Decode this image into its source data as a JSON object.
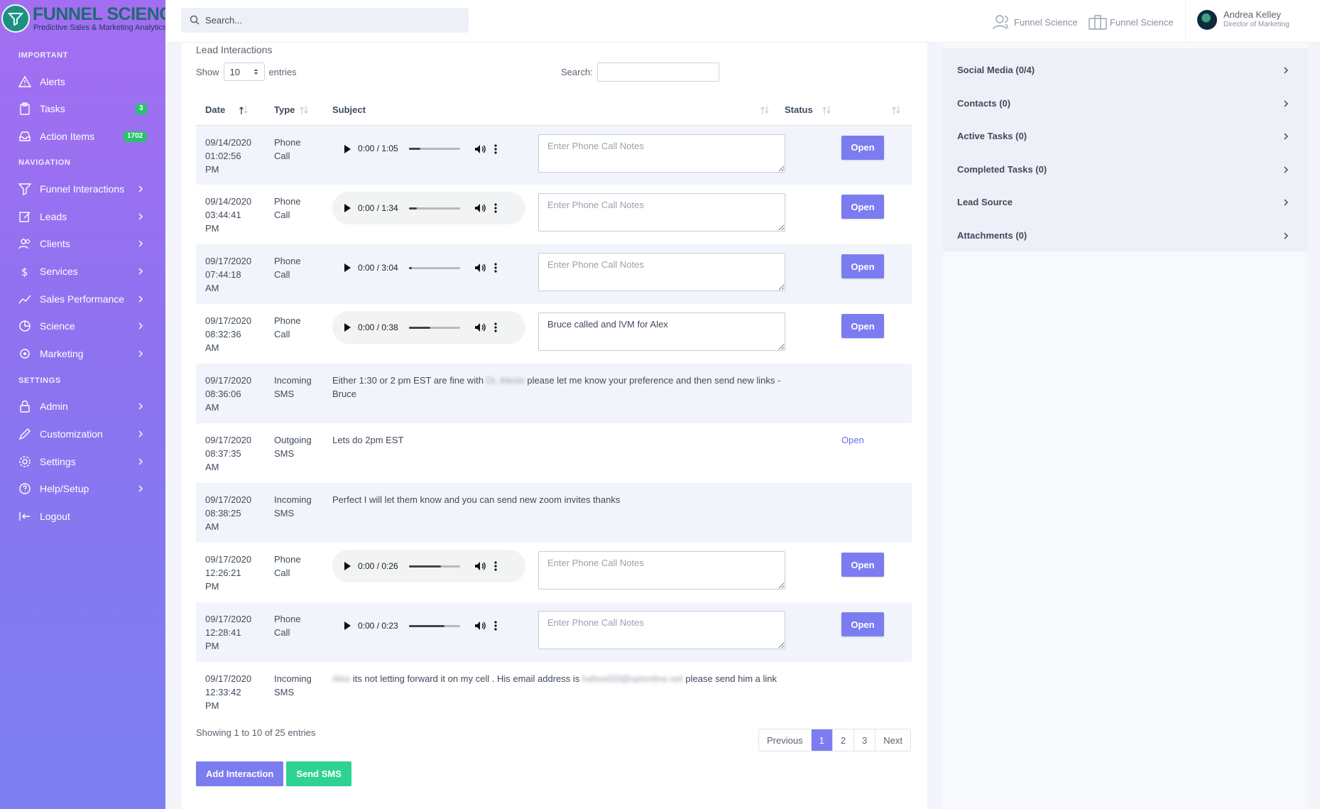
{
  "brand": {
    "title": "FUNNEL SCIENCE",
    "tagline": "Predictive Sales & Marketing Analytics"
  },
  "sidebar": {
    "sections": [
      {
        "label": "IMPORTANT"
      },
      {
        "label": "NAVIGATION"
      },
      {
        "label": "SETTINGS"
      }
    ],
    "items": [
      {
        "label": "Alerts",
        "icon": "alert-icon"
      },
      {
        "label": "Tasks",
        "icon": "clipboard-icon",
        "badge": "3"
      },
      {
        "label": "Action Items",
        "icon": "inbox-icon",
        "badge": "1702"
      },
      {
        "label": "Funnel Interactions",
        "icon": "funnel-icon"
      },
      {
        "label": "Leads",
        "icon": "edit-icon"
      },
      {
        "label": "Clients",
        "icon": "users-icon"
      },
      {
        "label": "Services",
        "icon": "dollar-icon"
      },
      {
        "label": "Sales Performance",
        "icon": "trend-icon"
      },
      {
        "label": "Science",
        "icon": "pie-icon"
      },
      {
        "label": "Marketing",
        "icon": "target-icon"
      },
      {
        "label": "Admin",
        "icon": "lock-icon"
      },
      {
        "label": "Customization",
        "icon": "pen-icon"
      },
      {
        "label": "Settings",
        "icon": "gear-icon"
      },
      {
        "label": "Help/Setup",
        "icon": "help-icon"
      },
      {
        "label": "Logout",
        "icon": "logout-icon"
      }
    ]
  },
  "header": {
    "search_placeholder": "Search...",
    "link1": "Funnel Science",
    "link2": "Funnel Science",
    "user_name": "Andrea Kelley",
    "user_role": "Director of Marketing"
  },
  "main": {
    "title": "Lead Interactions",
    "show_label": "Show",
    "entries_label": "entries",
    "page_size": "10",
    "search_label": "Search:",
    "columns": {
      "date": "Date",
      "type": "Type",
      "subject": "Subject",
      "status": "Status"
    },
    "notes_placeholder": "Enter Phone Call Notes",
    "open_label": "Open",
    "rows": [
      {
        "date1": "09/14/2020",
        "date2": "01:02:56",
        "date3": "PM",
        "type1": "Phone",
        "type2": "Call",
        "time": "0:00 / 1:05",
        "progress": 0.22,
        "note": ""
      },
      {
        "date1": "09/14/2020",
        "date2": "03:44:41",
        "date3": "PM",
        "type1": "Phone",
        "type2": "Call",
        "time": "0:00 / 1:34",
        "progress": 0.15,
        "note": ""
      },
      {
        "date1": "09/17/2020",
        "date2": "07:44:18",
        "date3": "AM",
        "type1": "Phone",
        "type2": "Call",
        "time": "0:00 / 3:04",
        "progress": 0.06,
        "note": ""
      },
      {
        "date1": "09/17/2020",
        "date2": "08:32:36",
        "date3": "AM",
        "type1": "Phone",
        "type2": "Call",
        "time": "0:00 / 0:38",
        "progress": 0.42,
        "note": "Bruce called and lVM for Alex"
      },
      {
        "date1": "09/17/2020",
        "date2": "08:36:06",
        "date3": "AM",
        "type1": "Incoming",
        "type2": "SMS",
        "msg_a": "Either 1:30 or 2 pm EST are fine with",
        "msg_blur": "Dr. Alexis",
        "msg_b": "please let me know your preference and then send new links -",
        "msg_c": "Bruce"
      },
      {
        "date1": "09/17/2020",
        "date2": "08:37:35",
        "date3": "AM",
        "type1": "Outgoing",
        "type2": "SMS",
        "msg_a": "Lets do 2pm EST",
        "status_link": "Open"
      },
      {
        "date1": "09/17/2020",
        "date2": "08:38:25",
        "date3": "AM",
        "type1": "Incoming",
        "type2": "SMS",
        "msg_a": "Perfect I will let them know and you can send new zoom invites thanks"
      },
      {
        "date1": "09/17/2020",
        "date2": "12:26:21",
        "date3": "PM",
        "type1": "Phone",
        "type2": "Call",
        "time": "0:00 / 0:26",
        "progress": 0.62,
        "note": ""
      },
      {
        "date1": "09/17/2020",
        "date2": "12:28:41",
        "date3": "PM",
        "type1": "Phone",
        "type2": "Call",
        "time": "0:00 / 0:23",
        "progress": 0.7,
        "note": ""
      },
      {
        "date1": "09/17/2020",
        "date2": "12:33:42",
        "date3": "PM",
        "type1": "Incoming",
        "type2": "SMS",
        "msg_blur0": "Alex",
        "msg_a": "its not letting forward it on my cell . His email address is",
        "msg_blur": "hafood33@optonline.net",
        "msg_b": "please send him a link"
      }
    ],
    "showing": "Showing 1 to 10 of 25 entries",
    "pager": {
      "prev": "Previous",
      "p1": "1",
      "p2": "2",
      "p3": "3",
      "next": "Next"
    },
    "add_interaction": "Add Interaction",
    "send_sms": "Send SMS"
  },
  "right_panel": {
    "items": [
      "Social Media (0/4)",
      "Contacts (0)",
      "Active Tasks (0)",
      "Completed Tasks (0)",
      "Lead Source",
      "Attachments (0)"
    ]
  },
  "colors": {
    "accent": "#7c7cf1",
    "success": "#2fd391",
    "badge": "#27c26c"
  }
}
